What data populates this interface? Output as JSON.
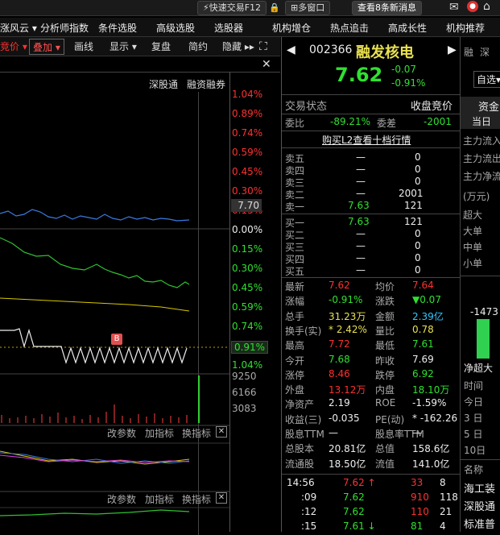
{
  "topbar": {
    "quick_trade": "快速交易F12",
    "multi_window": "多窗口",
    "view_messages": "查看8条新消息"
  },
  "menu": [
    "涨风云",
    "分析师指数",
    "条件选股",
    "高级选股",
    "选股器",
    "机构增仓",
    "热点追击",
    "高成长性",
    "机构推荐"
  ],
  "toolbar": {
    "auction": "竞价",
    "overlay": "叠加",
    "draw_line": "画线",
    "display": "显示",
    "replay": "复盘",
    "simple": "简约",
    "hide": "隐藏",
    "expand": "⛶"
  },
  "chart_header": {
    "sz_connect": "深股通",
    "margin": "融资融券"
  },
  "price_axis": {
    "up_labels": [
      "1.04%",
      "0.89%",
      "0.74%",
      "0.59%",
      "0.45%",
      "0.30%",
      "0.15%"
    ],
    "price_tag": "7.70",
    "zero": "0.00%",
    "down_labels": [
      "0.15%",
      "0.30%",
      "0.45%",
      "0.59%",
      "0.74%"
    ],
    "pct_tag": "0.91%",
    "bottom": "1.04%"
  },
  "volume_axis": [
    "9250",
    "6166",
    "3083"
  ],
  "indicator_bar_1": {
    "change_params": "改参数",
    "add_indicator": "加指标",
    "switch_indicator": "换指标"
  },
  "indicator_bar_2": {
    "change_params": "改参数",
    "add_indicator": "加指标",
    "switch_indicator": "换指标"
  },
  "b_marker": "B",
  "stock": {
    "code": "002366",
    "name": "融发核电",
    "price": "7.62",
    "change": "-0.07",
    "change_pct": "-0.91%"
  },
  "side_tabs": {
    "margin_short": "融",
    "sz": "深",
    "self_select": "自选"
  },
  "trade_status": {
    "label": "交易状态",
    "value": "收盘竞价"
  },
  "order_ratio": {
    "label": "委比",
    "value": "-89.21%",
    "diff_label": "委差",
    "diff_value": "-2001"
  },
  "buy_l2": "购买L2查看十档行情",
  "asks": [
    {
      "label": "卖五",
      "price": "—",
      "vol": "0"
    },
    {
      "label": "卖四",
      "price": "—",
      "vol": "0"
    },
    {
      "label": "卖三",
      "price": "—",
      "vol": "0"
    },
    {
      "label": "卖二",
      "price": "—",
      "vol": "2001"
    },
    {
      "label": "卖一",
      "price": "7.63",
      "vol": "121"
    }
  ],
  "bids": [
    {
      "label": "买一",
      "price": "7.63",
      "vol": "121"
    },
    {
      "label": "买二",
      "price": "—",
      "vol": "0"
    },
    {
      "label": "买三",
      "price": "—",
      "vol": "0"
    },
    {
      "label": "买四",
      "price": "—",
      "vol": "0"
    },
    {
      "label": "买五",
      "price": "—",
      "vol": "0"
    }
  ],
  "stats": [
    {
      "l1": "最新",
      "v1": "7.62",
      "c1": "red",
      "l2": "均价",
      "v2": "7.64",
      "c2": "red"
    },
    {
      "l1": "涨幅",
      "v1": "-0.91%",
      "c1": "green",
      "l2": "涨跌",
      "v2": "▼0.07",
      "c2": "green"
    },
    {
      "l1": "总手",
      "v1": "31.23万",
      "c1": "yellow",
      "l2": "金额",
      "v2": "2.39亿",
      "c2": "cyan"
    },
    {
      "l1": "换手(实)",
      "v1": "* 2.42%",
      "c1": "yellow",
      "l2": "量比",
      "v2": "0.78",
      "c2": "yellow"
    },
    {
      "l1": "最高",
      "v1": "7.72",
      "c1": "red",
      "l2": "最低",
      "v2": "7.61",
      "c2": "green"
    },
    {
      "l1": "今开",
      "v1": "7.68",
      "c1": "green",
      "l2": "昨收",
      "v2": "7.69",
      "c2": "white"
    },
    {
      "l1": "涨停",
      "v1": "8.46",
      "c1": "red",
      "l2": "跌停",
      "v2": "6.92",
      "c2": "green"
    },
    {
      "l1": "外盘",
      "v1": "13.12万",
      "c1": "red",
      "l2": "内盘",
      "v2": "18.10万",
      "c2": "green"
    },
    {
      "l1": "净资产",
      "v1": "2.19",
      "c1": "white",
      "l2": "ROE",
      "v2": "-1.59%",
      "c2": "white"
    },
    {
      "l1": "收益(三)",
      "v1": "-0.035",
      "c1": "white",
      "l2": "PE(动)",
      "v2": "* -162.26",
      "c2": "white"
    },
    {
      "l1": "股息TTM",
      "v1": "—",
      "c1": "white",
      "l2": "股息率TTM",
      "v2": "—",
      "c2": "white"
    },
    {
      "l1": "总股本",
      "v1": "20.81亿",
      "c1": "white",
      "l2": "总值",
      "v2": "158.6亿",
      "c2": "white"
    },
    {
      "l1": "流通股",
      "v1": "18.50亿",
      "c1": "white",
      "l2": "流值",
      "v2": "141.0亿",
      "c2": "white"
    }
  ],
  "ticks": [
    {
      "time": "14:56",
      "price": "7.62",
      "arrow": "↑",
      "vol": "33",
      "n": "8",
      "pc": "red",
      "vc": "red"
    },
    {
      "time": ":09",
      "price": "7.62",
      "arrow": "",
      "vol": "910",
      "n": "118",
      "pc": "green",
      "vc": "red"
    },
    {
      "time": ":12",
      "price": "7.62",
      "arrow": "",
      "vol": "110",
      "n": "21",
      "pc": "green",
      "vc": "red"
    },
    {
      "time": ":15",
      "price": "7.61",
      "arrow": "↓",
      "vol": "81",
      "n": "4",
      "pc": "green",
      "vc": "green"
    }
  ],
  "funds": {
    "tab_funds": "资金",
    "tab_today": "当日",
    "main_in": "主力流入",
    "main_out": "主力流出",
    "main_net": "主力净流",
    "unit": "(万元)",
    "sizes": [
      "超大",
      "大单",
      "中单",
      "小单"
    ],
    "bar_value": "-1473",
    "bar_fraction": 0.7,
    "net_super": "净超大",
    "time_label": "时间",
    "periods": [
      "今日",
      "3 日",
      "5 日",
      "10日"
    ],
    "name_label": "名称",
    "names": [
      "海工装",
      "深股通",
      "标准普"
    ]
  }
}
